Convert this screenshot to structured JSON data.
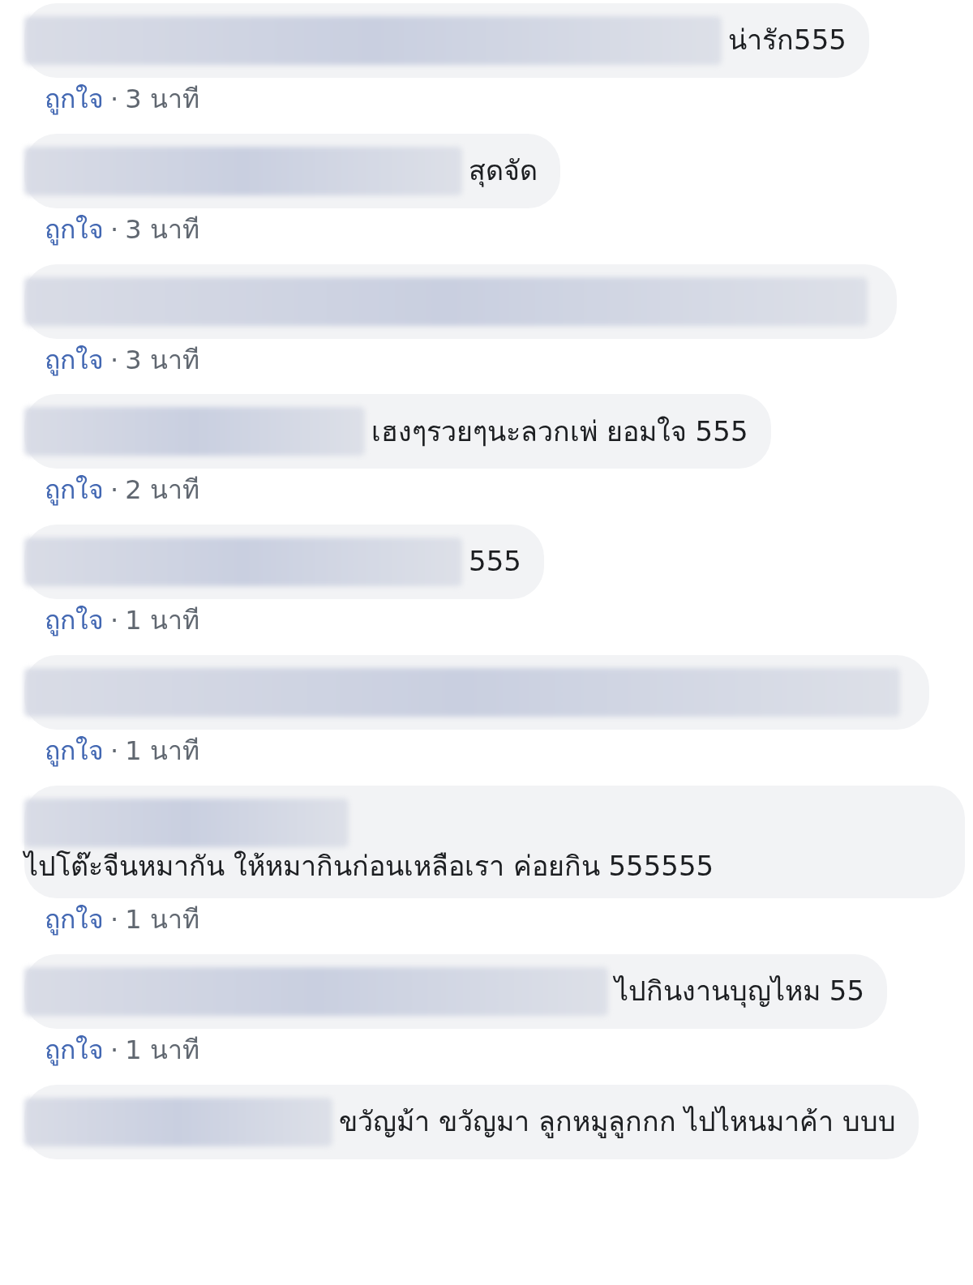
{
  "comments": [
    {
      "text": "น่ารัก555",
      "like": "ถูกใจ",
      "separator": "·",
      "time": "3 นาที"
    },
    {
      "text": "สุดจัด",
      "like": "ถูกใจ",
      "separator": "·",
      "time": "3 นาที"
    },
    {
      "like": "ถูกใจ",
      "separator": "·",
      "time": "3 นาที"
    },
    {
      "text": "เฮงๆรวยๆนะลวกเพ่ ยอมใจ 555",
      "like": "ถูกใจ",
      "separator": "·",
      "time": "2 นาที"
    },
    {
      "text": "555",
      "like": "ถูกใจ",
      "separator": "·",
      "time": "1 นาที"
    },
    {
      "like": "ถูกใจ",
      "separator": "·",
      "time": "1 นาที"
    },
    {
      "text": "ไปโต๊ะจีนหมากัน ให้หมากินก่อนเหลือเรา ค่อยกิน 555555",
      "like": "ถูกใจ",
      "separator": "·",
      "time": "1 นาที"
    },
    {
      "text": "ไปกินงานบุญไหม 55",
      "like": "ถูกใจ",
      "separator": "·",
      "time": "1 นาที"
    },
    {
      "text": "ขวัญม้า ขวัญมา ลูกหมูลูกกก ไปไหนมาค้า บบบ"
    }
  ]
}
